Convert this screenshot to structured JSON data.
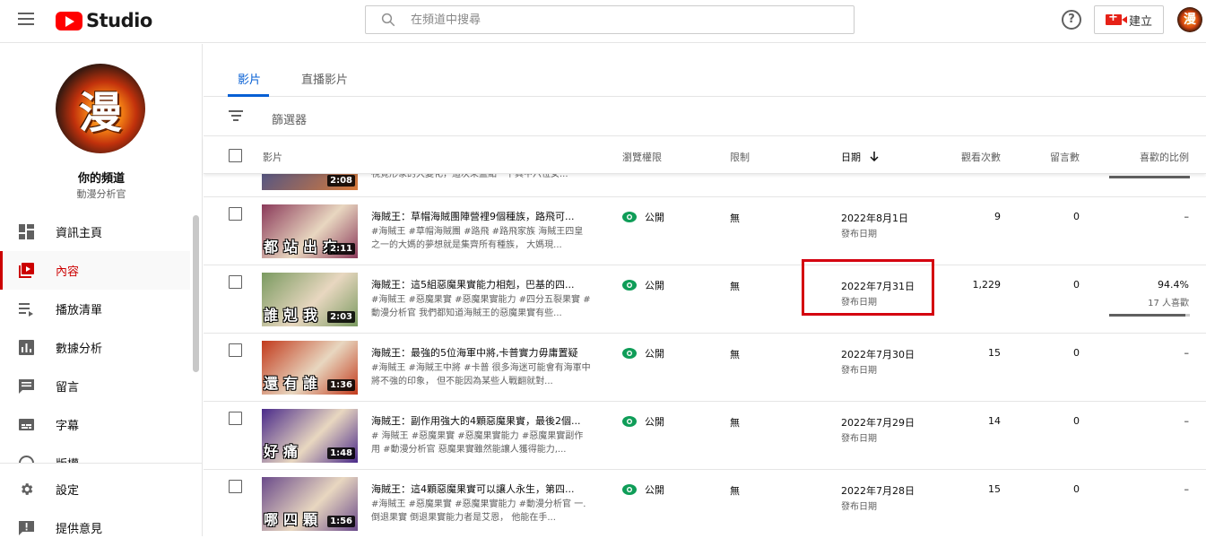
{
  "header": {
    "logo_text": "Studio",
    "search_placeholder": "在頻道中搜尋",
    "help_label": "?",
    "create_label": "建立",
    "avatar_char": "漫"
  },
  "sidebar": {
    "avatar_char": "漫",
    "channel_name": "你的頻道",
    "channel_sub": "動漫分析官",
    "items": [
      {
        "label": "資訊主頁",
        "icon": "dashboard-icon"
      },
      {
        "label": "內容",
        "icon": "content-icon",
        "active": true
      },
      {
        "label": "播放清單",
        "icon": "playlist-icon"
      },
      {
        "label": "數據分析",
        "icon": "analytics-icon"
      },
      {
        "label": "留言",
        "icon": "comments-icon"
      },
      {
        "label": "字幕",
        "icon": "subtitles-icon"
      },
      {
        "label": "版權",
        "icon": "copyright-icon"
      },
      {
        "label": "設定",
        "icon": "settings-icon"
      },
      {
        "label": "提供意見",
        "icon": "feedback-icon"
      }
    ]
  },
  "tabs": [
    {
      "label": "影片",
      "active": true
    },
    {
      "label": "直播影片"
    }
  ],
  "filter_label": "篩選器",
  "columns": {
    "video": "影片",
    "visibility": "瀏覽權限",
    "restrictions": "限制",
    "date": "日期",
    "views": "觀看次數",
    "comments": "留言數",
    "likes": "喜歡的比例"
  },
  "partial_row": {
    "duration": "2:08",
    "desc": "視覺形象的大變化，這次來盤點一下其中六位女..."
  },
  "rows": [
    {
      "title": "海賊王：草帽海賊團陣營裡9個種族，路飛可...",
      "desc": "#海賊王 #草帽海賊團 #路飛 #路飛家族 海賊王四皇之一的大媽的夢想就是集齊所有種族， 大媽現...",
      "thumb_caption": "都站出來",
      "duration": "2:11",
      "visibility": "公開",
      "restrictions": "無",
      "date": "2022年8月1日",
      "date_sub": "發布日期",
      "views": "9",
      "comments": "0",
      "likes": "–",
      "likes_sub": "",
      "like_ratio": null,
      "accent": "#8b3a5a"
    },
    {
      "title": "海賊王：這5組惡魔果實能力相剋，巴基的四...",
      "desc": "#海賊王 #惡魔果實 #惡魔果實能力 #四分五裂果實 #動漫分析官 我們都知道海賊王的惡魔果實有些...",
      "thumb_caption": "誰剋我",
      "duration": "2:03",
      "visibility": "公開",
      "restrictions": "無",
      "date": "2022年7月31日",
      "date_sub": "發布日期",
      "views": "1,229",
      "comments": "0",
      "likes": "94.4%",
      "likes_sub": "17 人喜歡",
      "like_ratio": 0.944,
      "accent": "#7a9a60"
    },
    {
      "title": "海賊王：最強的5位海軍中將,卡普實力毋庸置疑",
      "desc": "#海賊王 #海賊王中將 #卡普 很多海迷可能會有海軍中將不強的印象， 但不能因為某些人戰翻就對...",
      "thumb_caption": "還有誰",
      "duration": "1:36",
      "visibility": "公開",
      "restrictions": "無",
      "date": "2022年7月30日",
      "date_sub": "發布日期",
      "views": "15",
      "comments": "0",
      "likes": "–",
      "likes_sub": "",
      "like_ratio": null,
      "accent": "#c23a1c"
    },
    {
      "title": "海賊王：副作用強大的4顆惡魔果實，最後2個...",
      "desc": "# 海賊王 #惡魔果實 #惡魔果實能力 #惡魔果實副作用 #動漫分析官 惡魔果實雖然能讓人獲得能力,...",
      "thumb_caption": "好痛",
      "duration": "1:48",
      "visibility": "公開",
      "restrictions": "無",
      "date": "2022年7月29日",
      "date_sub": "發布日期",
      "views": "14",
      "comments": "0",
      "likes": "–",
      "likes_sub": "",
      "like_ratio": null,
      "accent": "#4a2a8a"
    },
    {
      "title": "海賊王：這4顆惡魔果實可以讓人永生，第四...",
      "desc": "#海賊王 #惡魔果實 #惡魔果實能力 #動漫分析官 一.倒退果實 倒退果實能力者是艾恩， 他能在手...",
      "thumb_caption": "哪四顆",
      "duration": "1:56",
      "visibility": "公開",
      "restrictions": "無",
      "date": "2022年7月28日",
      "date_sub": "發布日期",
      "views": "15",
      "comments": "0",
      "likes": "–",
      "likes_sub": "",
      "like_ratio": null,
      "accent": "#6a4a8a"
    }
  ],
  "colors": {
    "accent_blue": "#065fd4",
    "active_red": "#cc0000",
    "highlight_red": "#d4000f",
    "public_green": "#0f9d58"
  }
}
